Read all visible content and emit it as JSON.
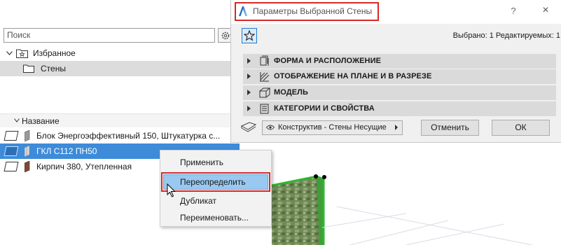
{
  "left_panel": {
    "search_placeholder": "Поиск",
    "tree": {
      "favorites": "Избранное",
      "walls": "Стены"
    },
    "list_header": "Название",
    "rows": [
      {
        "label": "Блок Энергоэффективный 150, Штукатурка с..."
      },
      {
        "label": "ГКЛ С112 ПН50"
      },
      {
        "label": "Кирпич 380, Утепленная"
      }
    ]
  },
  "dialog": {
    "title": "Параметры Выбранной Стены",
    "help": "?",
    "close": "×",
    "selected_info": "Выбрано: 1 Редактируемых: 1",
    "sections": [
      {
        "label": "ФОРМА И РАСПОЛОЖЕНИЕ"
      },
      {
        "label": "ОТОБРАЖЕНИЕ НА ПЛАНЕ И В РАЗРЕЗЕ"
      },
      {
        "label": "МОДЕЛЬ"
      },
      {
        "label": "КАТЕГОРИИ И СВОЙСТВА"
      }
    ],
    "type_select": "Конструктив - Стены Несущие",
    "cancel": "Отменить",
    "ok": "ОК"
  },
  "context_menu": {
    "items": [
      "Применить",
      "Переопределить",
      "Дубликат",
      "Переименовать..."
    ]
  },
  "colors": {
    "highlight_red": "#d42a2a",
    "selection_blue": "#3d8bd9",
    "menu_hover": "#99c8f0"
  }
}
